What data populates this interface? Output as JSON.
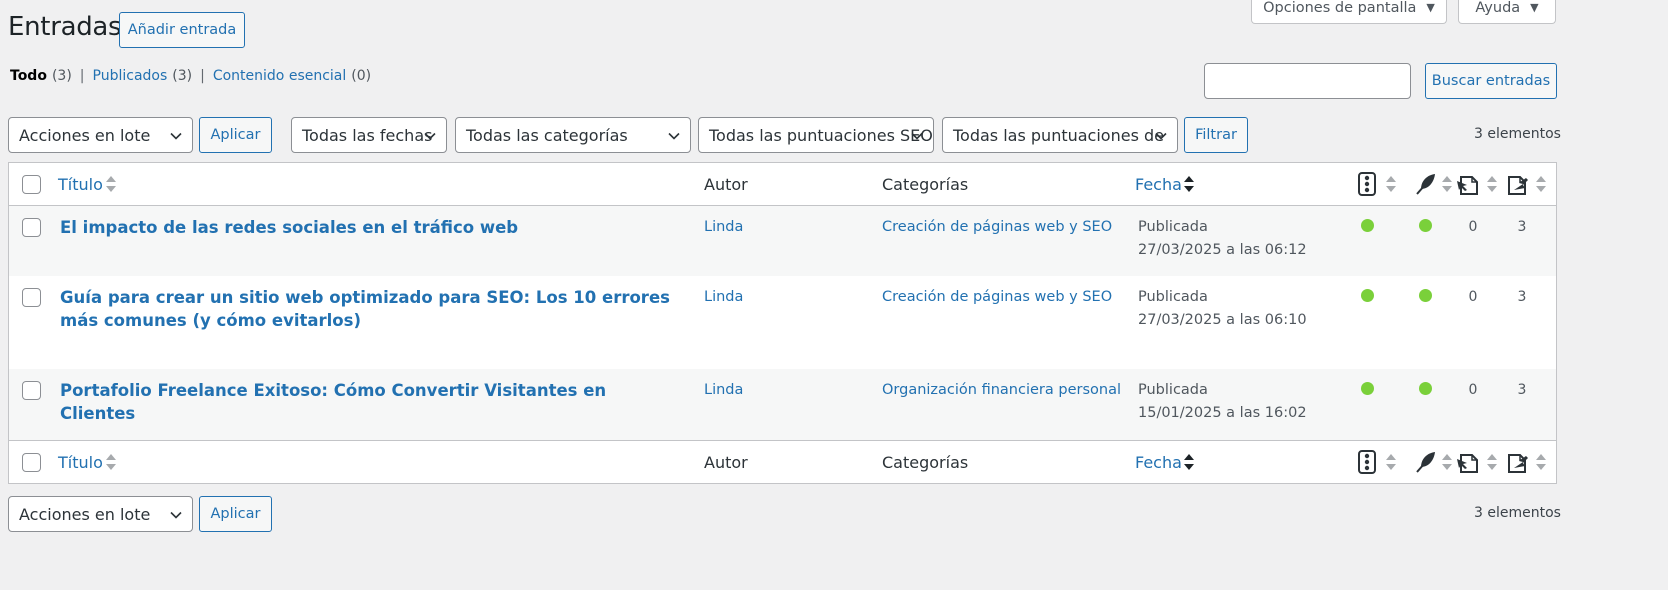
{
  "header": {
    "title": "Entradas",
    "add_button": "Añadir entrada",
    "screen_options": "Opciones de pantalla",
    "help": "Ayuda"
  },
  "views": {
    "all_label": "Todo",
    "all_count": "(3)",
    "published_label": "Publicados",
    "published_count": "(3)",
    "cornerstone_label": "Contenido esencial",
    "cornerstone_count": "(0)",
    "separator": "|"
  },
  "search": {
    "value": "",
    "button": "Buscar entradas"
  },
  "filters": {
    "bulk_actions": "Acciones en lote",
    "apply": "Aplicar",
    "dates": "Todas las fechas",
    "categories": "Todas las categorías",
    "seo_scores": "Todas las puntuaciones SEO",
    "readability_scores": "Todas las puntuaciones de",
    "filter": "Filtrar",
    "item_count": "3 elementos"
  },
  "columns": {
    "title": "Título",
    "author": "Autor",
    "categories": "Categorías",
    "date": "Fecha",
    "seo_icon": "traffic-light-icon",
    "readability_icon": "feather-icon",
    "inlinks_icon": "incoming-links-icon",
    "outlinks_icon": "outgoing-links-icon"
  },
  "posts": [
    {
      "title": "El impacto de las redes sociales en el tráfico web",
      "author": "Linda",
      "category": "Creación de páginas web y SEO",
      "status": "Publicada",
      "date": "27/03/2025 a las 06:12",
      "seo": "good",
      "readability": "good",
      "inlinks": "0",
      "outlinks": "3"
    },
    {
      "title": "Guía para crear un sitio web optimizado para SEO: Los 10 errores más comunes (y cómo evitarlos)",
      "author": "Linda",
      "category": "Creación de páginas web y SEO",
      "status": "Publicada",
      "date": "27/03/2025 a las 06:10",
      "seo": "good",
      "readability": "good",
      "inlinks": "0",
      "outlinks": "3"
    },
    {
      "title": "Portafolio Freelance Exitoso: Cómo Convertir Visitantes en Clientes",
      "author": "Linda",
      "category": "Organización financiera personal",
      "status": "Publicada",
      "date": "15/01/2025 a las 16:02",
      "seo": "good",
      "readability": "good",
      "inlinks": "0",
      "outlinks": "3"
    }
  ],
  "colors": {
    "accent": "#2271b1",
    "good_dot": "#7ad03a",
    "background": "#f0f0f1"
  }
}
